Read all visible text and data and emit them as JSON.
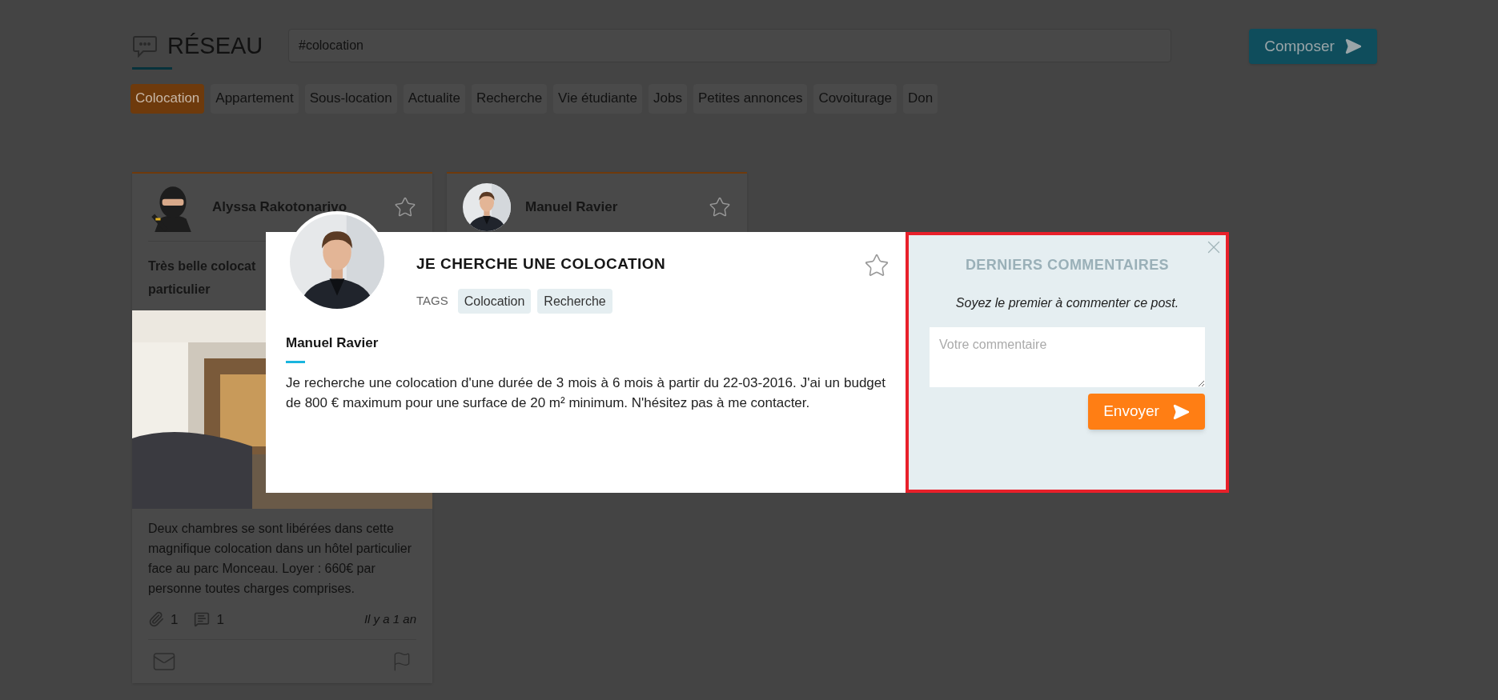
{
  "header": {
    "title": "RÉSEAU",
    "search": {
      "value": "#colocation"
    },
    "compose_button": "Composer"
  },
  "categories": [
    {
      "label": "Colocation",
      "selected": true
    },
    {
      "label": "Appartement",
      "selected": false
    },
    {
      "label": "Sous-location",
      "selected": false
    },
    {
      "label": "Actualite",
      "selected": false
    },
    {
      "label": "Recherche",
      "selected": false
    },
    {
      "label": "Vie étudiante",
      "selected": false
    },
    {
      "label": "Jobs",
      "selected": false
    },
    {
      "label": "Petites annonces",
      "selected": false
    },
    {
      "label": "Covoiturage",
      "selected": false
    },
    {
      "label": "Don",
      "selected": false
    }
  ],
  "cards": [
    {
      "author": "Alyssa Rakotonarivo",
      "avatar": {
        "kind": "illustration"
      },
      "favorite": false,
      "title_lines": [
        "Très belle colocat",
        "particulier"
      ],
      "description": "Deux chambres se sont libérées dans cette magnifique colocation dans un hôtel particulier face au parc Monceau. Loyer : 660€ par personne toutes charges comprises.",
      "attachments": "1",
      "comments": "1",
      "time": "Il y a 1 an"
    },
    {
      "author": "Manuel Ravier",
      "favorite": false
    }
  ],
  "modal": {
    "title": "JE CHERCHE UNE COLOCATION",
    "favorite": false,
    "tags_label": "TAGS",
    "tags": [
      "Colocation",
      "Recherche"
    ],
    "author": "Manuel Ravier",
    "body": "Je recherche une colocation d'une durée de 3 mois à 6 mois à partir du 22-03-2016. J'ai un budget de 800 € maximum pour une surface de 20 m² minimum. N'hésitez pas à me contacter.",
    "comments": {
      "title": "DERNIERS COMMENTAIRES",
      "empty_message": "Soyez le premier à commenter ce post.",
      "placeholder": "Votre commentaire",
      "submit": "Envoyer"
    }
  }
}
